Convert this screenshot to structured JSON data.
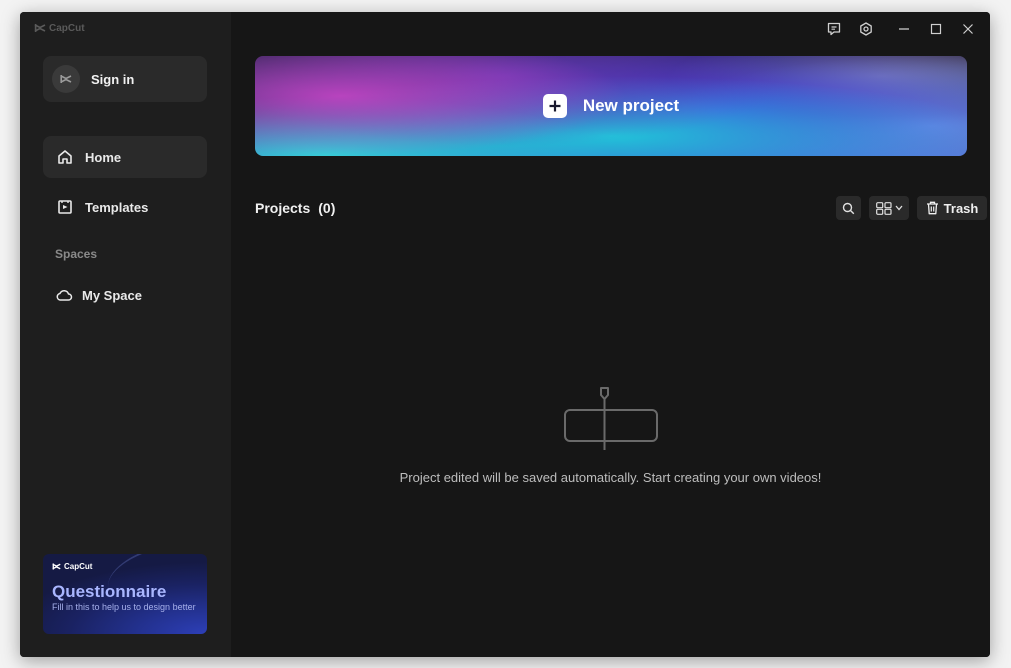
{
  "app": {
    "brand": "CapCut"
  },
  "sidebar": {
    "sign_in_label": "Sign in",
    "nav": [
      {
        "label": "Home",
        "icon": "home-icon",
        "active": true
      },
      {
        "label": "Templates",
        "icon": "templates-icon",
        "active": false
      }
    ],
    "spaces_title": "Spaces",
    "my_space_label": "My Space"
  },
  "questionnaire": {
    "brand": "CapCut",
    "title": "Questionnaire",
    "subtitle": "Fill in this to help us to design better"
  },
  "titlebar": {
    "icons": [
      "feedback-icon",
      "settings-icon",
      "minimize-icon",
      "maximize-icon",
      "close-icon"
    ]
  },
  "main": {
    "new_project_label": "New project",
    "projects_label": "Projects",
    "projects_count": "(0)",
    "trash_label": "Trash",
    "empty_message": "Project edited will be saved automatically. Start creating your own videos!"
  },
  "colors": {
    "window_bg": "#161616",
    "sidebar_bg": "#1e1e1e",
    "panel": "#2a2a2a",
    "questionnaire_accent": "#a9b6ff"
  }
}
